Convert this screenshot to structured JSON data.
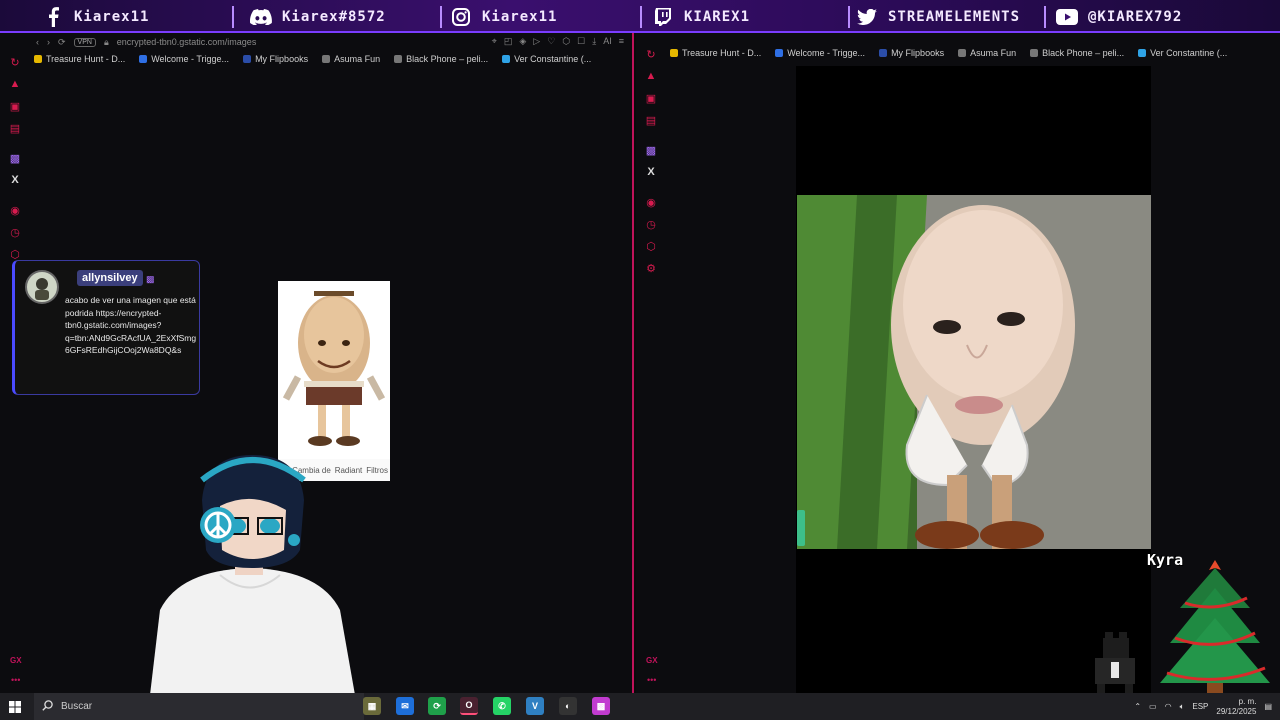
{
  "social": [
    {
      "icon": "facebook-icon",
      "label": "Kiarex11"
    },
    {
      "icon": "discord-icon",
      "label": "Kiarex#8572"
    },
    {
      "icon": "instagram-icon",
      "label": "Kiarex11"
    },
    {
      "icon": "twitch-icon",
      "label": "KIAREX1"
    },
    {
      "icon": "twitter-icon",
      "label": "STREAMELEMENTS"
    },
    {
      "icon": "youtube-icon",
      "label": "@KIAREX792"
    }
  ],
  "left_browser": {
    "vpn_label": "VPN",
    "url": "encrypted-tbn0.gstatic.com/images",
    "ai_label": "AI",
    "bookmarks": [
      "Treasure Hunt - D...",
      "Welcome - Trigge...",
      "My Flipbooks",
      "Asuma Fun",
      "Black Phone – peli...",
      "Ver Constantine (..."
    ],
    "gx_label": "GX"
  },
  "right_browser": {
    "bookmarks": [
      "Treasure Hunt - D...",
      "Welcome - Trigge...",
      "My Flipbooks",
      "Asuma Fun",
      "Black Phone – peli...",
      "Ver Constantine (..."
    ],
    "gx_label": "GX"
  },
  "chat": {
    "username": "allynsilvey",
    "message": "acabo de ver una imagen que está podrida https://encrypted-tbn0.gstatic.com/images?q=tbn:ANd9GcRAcfUA_2ExXfSmg6GFsREdhGijCOoj2Wa8DQ&s"
  },
  "egg_card": {
    "bottom_labels": [
      "",
      "Cambia de",
      "Radiant",
      "Filtros"
    ]
  },
  "overlay": {
    "name": "Kyra"
  },
  "taskbar": {
    "search_placeholder": "Buscar",
    "language": "ESP",
    "time": "p. m.",
    "date": "29/12/2025"
  },
  "colors": {
    "accent": "#7a3cff",
    "pane_border": "#c0135a"
  }
}
